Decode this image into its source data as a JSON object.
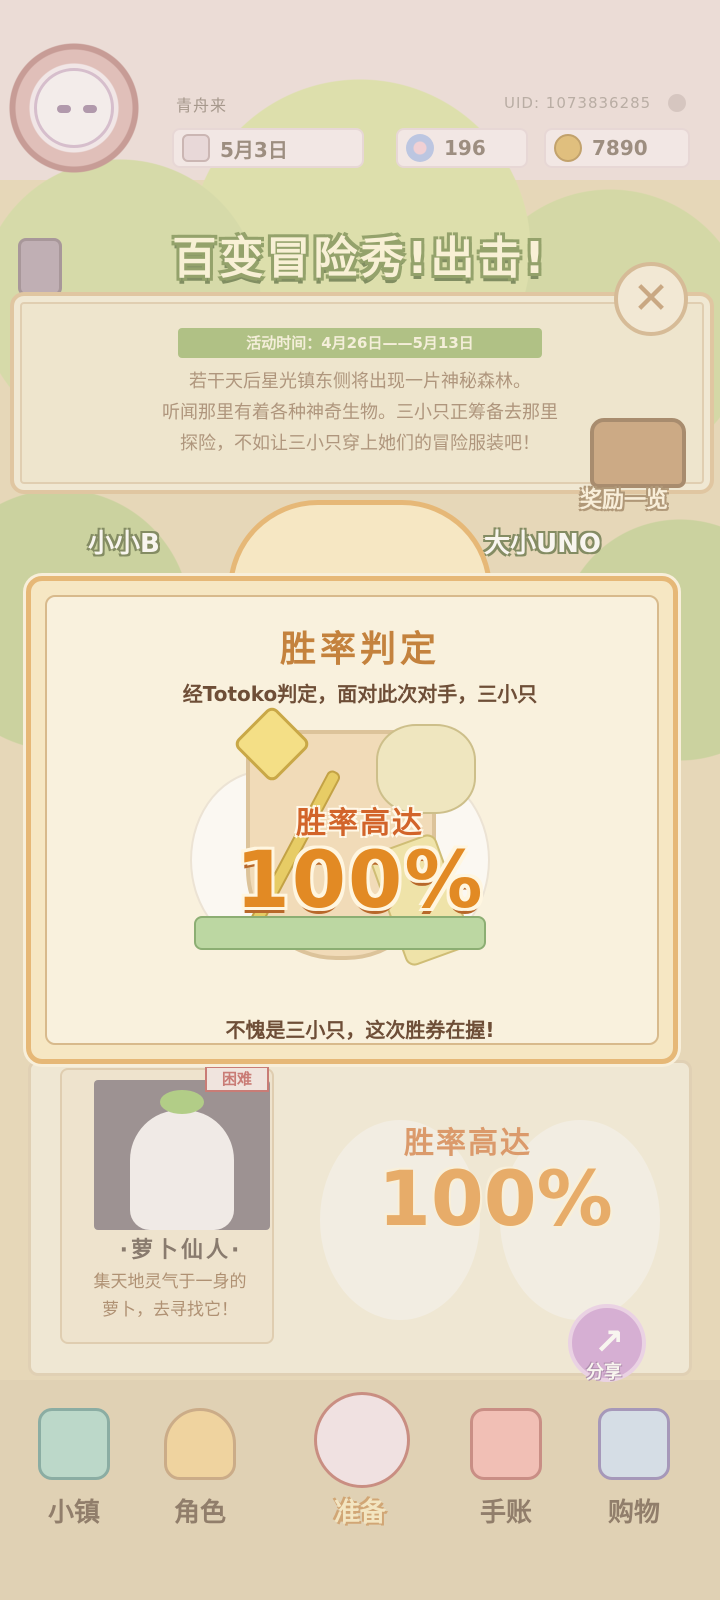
{
  "user": {
    "name": "青舟来",
    "uid": "UID: 1073836285",
    "date": "5月3日",
    "gems": "196",
    "coins": "7890"
  },
  "event": {
    "title": "百变冒险秀!出击!",
    "time": "活动时间：4月26日——5月13日",
    "description": [
      "若干天后星光镇东侧将出现一片神秘森林。",
      "听闻那里有着各种神奇生物。三小只正筹备去那里",
      "探险，不如让三小只穿上她们的冒险服装吧！"
    ],
    "close_icon": "close-icon",
    "rewards_label": "奖励一览"
  },
  "teams": {
    "left": "小小B",
    "right": "大小UNO"
  },
  "modal": {
    "title": "胜率判定",
    "subtitle": "经Totoko判定，面对此次对手，三小只",
    "rate_label": "胜率高达",
    "rate_value": "100%",
    "footer": "不愧是三小只，这次胜券在握!"
  },
  "card": {
    "tag": "困难",
    "name": "·萝卜仙人·",
    "description": [
      "集天地灵气于一身的",
      "萝卜，去寻找它！"
    ]
  },
  "board": {
    "rate_label": "胜率高达",
    "rate_value": "100%",
    "share_label": "分享"
  },
  "nav": {
    "items": [
      {
        "label": "小镇",
        "icon": "town-map-icon"
      },
      {
        "label": "角色",
        "icon": "character-icon"
      },
      {
        "label": "准备",
        "icon": "prepare-icon"
      },
      {
        "label": "手账",
        "icon": "diary-icon"
      },
      {
        "label": "购物",
        "icon": "shopping-bag-icon"
      }
    ],
    "active": "准备"
  },
  "colors": {
    "accent_orange": "#e28a24",
    "title_brown": "#c4823d",
    "event_green": "#8cac55",
    "modal_border": "#e6b877"
  }
}
